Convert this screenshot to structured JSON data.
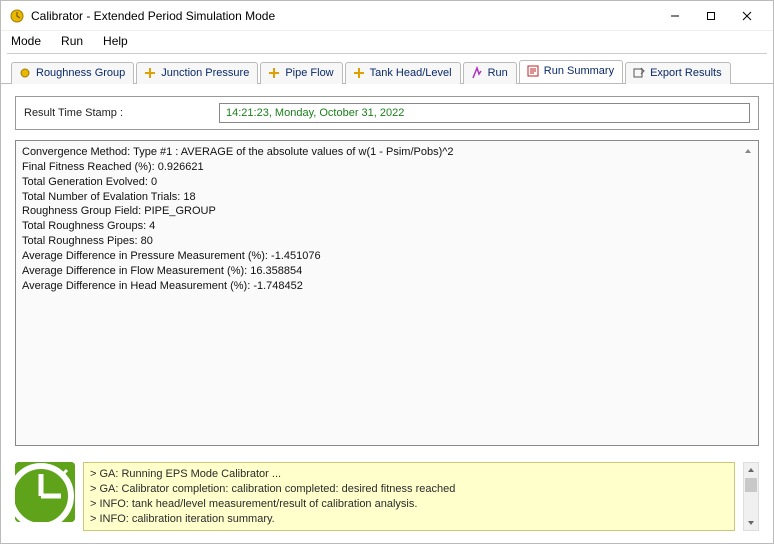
{
  "window": {
    "title": "Calibrator - Extended Period Simulation Mode"
  },
  "menu": {
    "mode": "Mode",
    "run": "Run",
    "help": "Help"
  },
  "tabs": {
    "roughness": "Roughness Group",
    "junction": "Junction Pressure",
    "pipe_flow": "Pipe Flow",
    "tank": "Tank Head/Level",
    "run": "Run",
    "run_summary": "Run Summary",
    "export": "Export Results"
  },
  "stamp": {
    "label": "Result Time Stamp :",
    "value": "14:21:23, Monday, October 31, 2022"
  },
  "summary": {
    "l1": "Convergence Method: Type #1 :  AVERAGE of the absolute values of w(1 - Psim/Pobs)^2",
    "l2": "Final Fitness Reached (%): 0.926621",
    "l3": "Total Generation Evolved: 0",
    "l4": "Total Number of Evalation Trials: 18",
    "l5": "Roughness Group Field: PIPE_GROUP",
    "l6": "Total Roughness Groups: 4",
    "l7": "Total Roughness Pipes: 80",
    "l8": "Average Difference in Pressure Measurement (%): -1.451076",
    "l9": "Average Difference in Flow Measurement (%): 16.358854",
    "l10": "Average Difference in Head Measurement (%): -1.748452"
  },
  "log": {
    "l1": "> GA: Running EPS Mode Calibrator ...",
    "l2": "> GA: Calibrator completion: calibration completed: desired fitness reached",
    "l3": "> INFO: tank head/level measurement/result of calibration analysis.",
    "l4": "> INFO: calibration iteration summary."
  }
}
